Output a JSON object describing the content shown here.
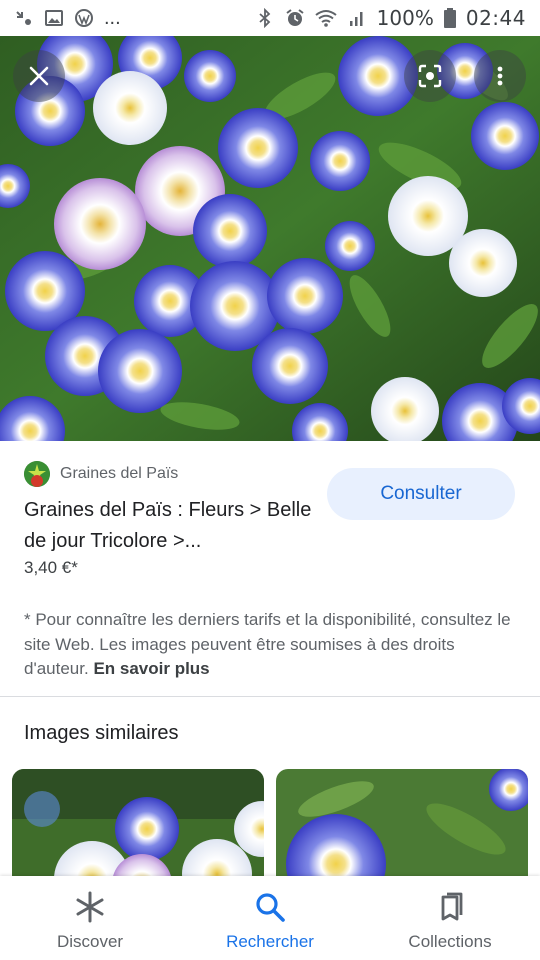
{
  "status_bar": {
    "battery_percent": "100%",
    "time": "02:44",
    "overflow": "..."
  },
  "result": {
    "source_name": "Graines del Païs",
    "title": "Graines del Païs : Fleurs > Belle de jour Tricolore >...",
    "price": "3,40 €*",
    "consult_label": "Consulter",
    "disclaimer_text": "* Pour connaître les derniers tarifs et la disponibilité, consultez le site Web. Les images peuvent être soumises à des droits d'auteur.",
    "learn_more_label": "En savoir plus"
  },
  "similar": {
    "heading": "Images similaires"
  },
  "bottom_nav": {
    "items": [
      {
        "label": "Discover",
        "icon": "asterisk-icon",
        "active": false
      },
      {
        "label": "Rechercher",
        "icon": "search-icon",
        "active": true
      },
      {
        "label": "Collections",
        "icon": "collections-icon",
        "active": false
      }
    ]
  },
  "colors": {
    "accent": "#1a73e8",
    "consult_bg": "#e8f0fe",
    "consult_text": "#1967d2"
  }
}
